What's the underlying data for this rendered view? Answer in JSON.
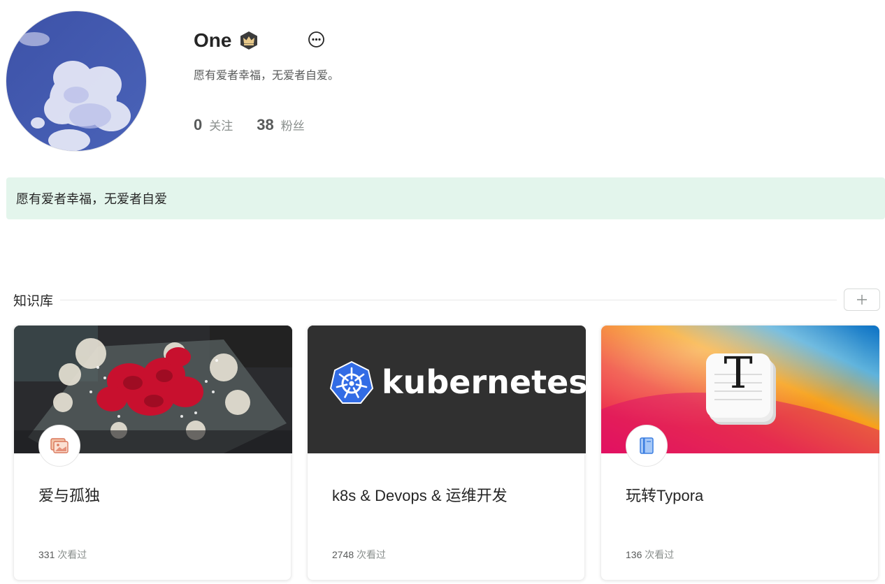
{
  "profile": {
    "name": "One",
    "bio": "愿有爱者幸福，无爱者自爱。",
    "stats": [
      {
        "num": "0",
        "label": "关注"
      },
      {
        "num": "38",
        "label": "粉丝"
      }
    ],
    "icons": {
      "badge": "crown-badge-icon",
      "more": "more-options-icon"
    }
  },
  "notice": {
    "text": "愿有爱者幸福，无爱者自爱"
  },
  "knowledge": {
    "title": "知识库",
    "add_icon": "plus-icon",
    "cards": [
      {
        "title": "爱与孤独",
        "views": "331",
        "views_label": "次看过",
        "icon": "image-icon"
      },
      {
        "title": "k8s & Devops & 运维开发",
        "views": "2748",
        "views_label": "次看过",
        "cover_text": "kubernetes",
        "icon": "none"
      },
      {
        "title": "玩转Typora",
        "views": "136",
        "views_label": "次看过",
        "cover_text": "T",
        "icon": "book-icon"
      }
    ]
  },
  "colors": {
    "accent_notice_bg": "#e3f5ec",
    "text": "#262626",
    "muted": "#8a8f8d"
  }
}
